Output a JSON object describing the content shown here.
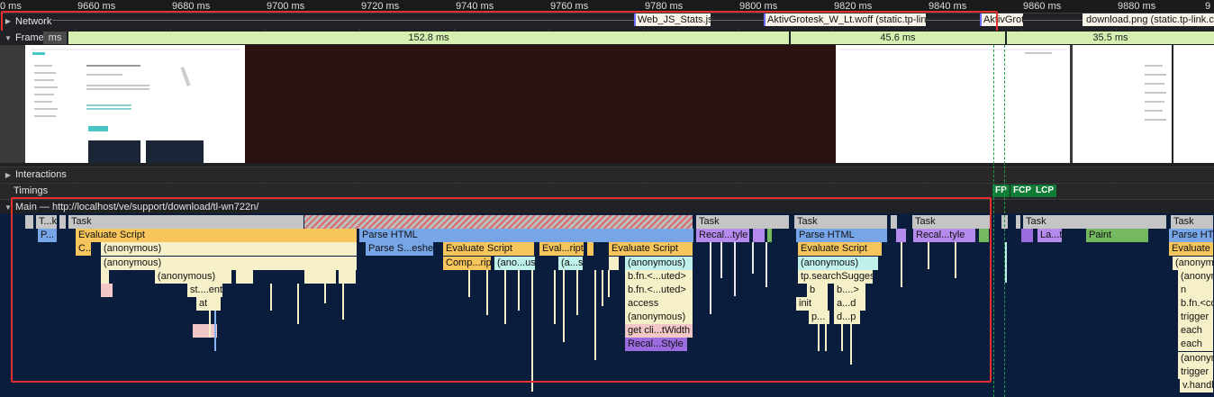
{
  "ruler": {
    "ticks": [
      "0 ms",
      "9660 ms",
      "9680 ms",
      "9700 ms",
      "9720 ms",
      "9740 ms",
      "9760 ms",
      "9780 ms",
      "9800 ms",
      "9820 ms",
      "9840 ms",
      "9860 ms",
      "9880 ms",
      "9"
    ]
  },
  "network": {
    "label": "Network",
    "requests": [
      "Web_JS_Stats.js (sta",
      "AktivGrotesk_W_Lt.woff (static.tp-link.co",
      "AktivGrote",
      "download.png (static.tp-link.com"
    ]
  },
  "frames": {
    "label": "Frames",
    "durations": [
      "ms",
      "152.8 ms",
      "45.6 ms",
      "35.5 ms"
    ]
  },
  "tracks": {
    "interactions": "Interactions",
    "timings": "Timings",
    "markers": {
      "fp": "FP",
      "fcp": "FCP",
      "lcp": "LCP"
    },
    "main": "Main — http://localhost/ve/support/download/tl-wn722n/"
  },
  "flame": {
    "row0": [
      "T...k",
      "Task",
      "Task",
      "Task",
      "Task",
      "Task",
      "Task"
    ],
    "row1": [
      "P...",
      "Evaluate Script",
      "Parse HTML",
      "Recal...tyle",
      "Parse HTML",
      "Recal...tyle",
      "La...t",
      "Paint",
      "Parse HTM"
    ],
    "row2": [
      "C...",
      "(anonymous)",
      "Parse S...esheet",
      "Evaluate Script",
      "Eval...ript",
      "Evaluate Script",
      "Evaluate Script",
      "Evaluate Script"
    ],
    "row3": [
      "(anonymous)",
      "Comp...ript",
      "(ano...us)",
      "(a...s)",
      "(anonymous)",
      "(anonymous)",
      "(anonym"
    ],
    "row4": [
      "(anonymous)",
      "b.fn.<...uted>",
      "tp.searchSuggest"
    ],
    "row5": [
      "st....ent",
      "b",
      "b....>",
      "n"
    ],
    "row6": [
      "at",
      "access",
      "init",
      "a...d",
      "b.fn.<co"
    ],
    "row7": [
      "(anonymous)",
      "p...",
      "d...p",
      "trigger"
    ],
    "row8": [
      "get cli...tWidth",
      "each"
    ],
    "row9": [
      "Recal...Style",
      "each"
    ],
    "row10": [
      "(anonym"
    ],
    "row11": [
      "trigger"
    ],
    "row12": [
      "v.handl"
    ]
  },
  "colors": {
    "script": "#f6c65c",
    "parse": "#76a5e8",
    "style": "#b48aed",
    "paint": "#74b85f",
    "fp": "#0f7b34",
    "fcp": "#0f7b34",
    "lcp": "#0f7b34",
    "highlight": "#e03030"
  }
}
